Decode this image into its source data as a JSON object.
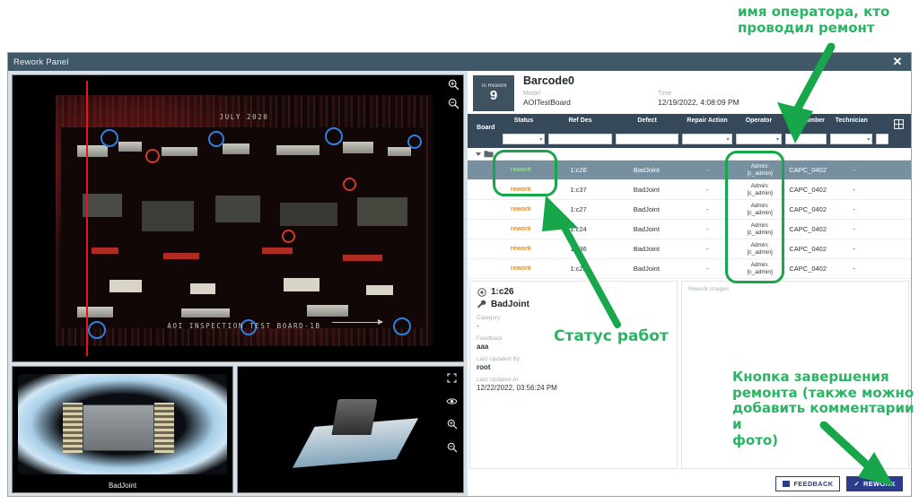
{
  "window": {
    "title": "Rework Panel",
    "close_icon": "close-icon"
  },
  "annotations": {
    "operator": "имя оператора, кто\nпроводил ремонт",
    "status": "Статус работ",
    "rework_button": "Кнопка завершения\nремонта (также можно\nдобавить комментарии и\nфото)",
    "color": "#2bb463"
  },
  "left_pane": {
    "board_view": {
      "silk_date": "JULY 2020",
      "silk_label": "AOI INSPECTION TEST BOARD-1B",
      "tools": [
        "zoom-in-icon",
        "zoom-out-icon"
      ]
    },
    "image_2d": {
      "label": "BadJoint"
    },
    "image_3d": {
      "tools": [
        "fullscreen-icon",
        "eye-icon",
        "zoom-in-icon",
        "zoom-out-icon"
      ]
    }
  },
  "header": {
    "to_rework_label": "To Rework",
    "to_rework_count": "9",
    "barcode": "Barcode0",
    "model_label": "Model",
    "model_value": "AOITestBoard",
    "time_label": "Time",
    "time_value": "12/19/2022, 4:08:09 PM"
  },
  "grid": {
    "columns": [
      "Board",
      "Status",
      "Ref Des",
      "Defect",
      "Repair Action",
      "Operator",
      "Part Number",
      "Technician"
    ],
    "filters": {
      "status": "",
      "ref_des": "",
      "defect": "",
      "repair_action": "",
      "operator": "",
      "part_number": "",
      "technician": ""
    },
    "column_chooser_icon": "grid-columns-icon",
    "tree_node_icon": "folder-icon",
    "rows": [
      {
        "status": "rework",
        "ref_des": "1:c26",
        "defect": "BadJoint",
        "repair_action": "-",
        "operator": "Admin:\n[c_admin]",
        "part_number": "CAPC_0402",
        "technician": "-",
        "selected": true
      },
      {
        "status": "rework",
        "ref_des": "1:c37",
        "defect": "BadJoint",
        "repair_action": "-",
        "operator": "Admin:\n[c_admin]",
        "part_number": "CAPC_0402",
        "technician": "-",
        "selected": false
      },
      {
        "status": "rework",
        "ref_des": "1:c27",
        "defect": "BadJoint",
        "repair_action": "-",
        "operator": "Admin:\n[c_admin]",
        "part_number": "CAPC_0402",
        "technician": "-",
        "selected": false
      },
      {
        "status": "rework",
        "ref_des": "1:c24",
        "defect": "BadJoint",
        "repair_action": "-",
        "operator": "Admin:\n[c_admin]",
        "part_number": "CAPC_0402",
        "technician": "-",
        "selected": false
      },
      {
        "status": "rework",
        "ref_des": "1:c36",
        "defect": "BadJoint",
        "repair_action": "-",
        "operator": "Admin:\n[c_admin]",
        "part_number": "CAPC_0402",
        "technician": "-",
        "selected": false
      },
      {
        "status": "rework",
        "ref_des": "1:c22",
        "defect": "BadJoint",
        "repair_action": "-",
        "operator": "Admin:\n[c_admin]",
        "part_number": "CAPC_0402",
        "technician": "-",
        "selected": false
      }
    ]
  },
  "detail": {
    "ref_des_icon": "target-icon",
    "ref_des": "1:c26",
    "defect_icon": "wrench-icon",
    "defect": "BadJoint",
    "category_label": "Category",
    "category_value": "-",
    "feedback_label": "Feedback",
    "feedback_value": "aaa",
    "updated_by_label": "Last Updated By",
    "updated_by_value": "root",
    "updated_at_label": "Last Updated At",
    "updated_at_value": "12/22/2022, 03:56:24 PM"
  },
  "rework_images": {
    "label": "Rework Images"
  },
  "footer": {
    "feedback_label": "FEEDBACK",
    "feedback_icon": "comment-icon",
    "rework_label": "REWORK",
    "rework_icon": "check-icon",
    "accent": "#2b3c8c"
  }
}
